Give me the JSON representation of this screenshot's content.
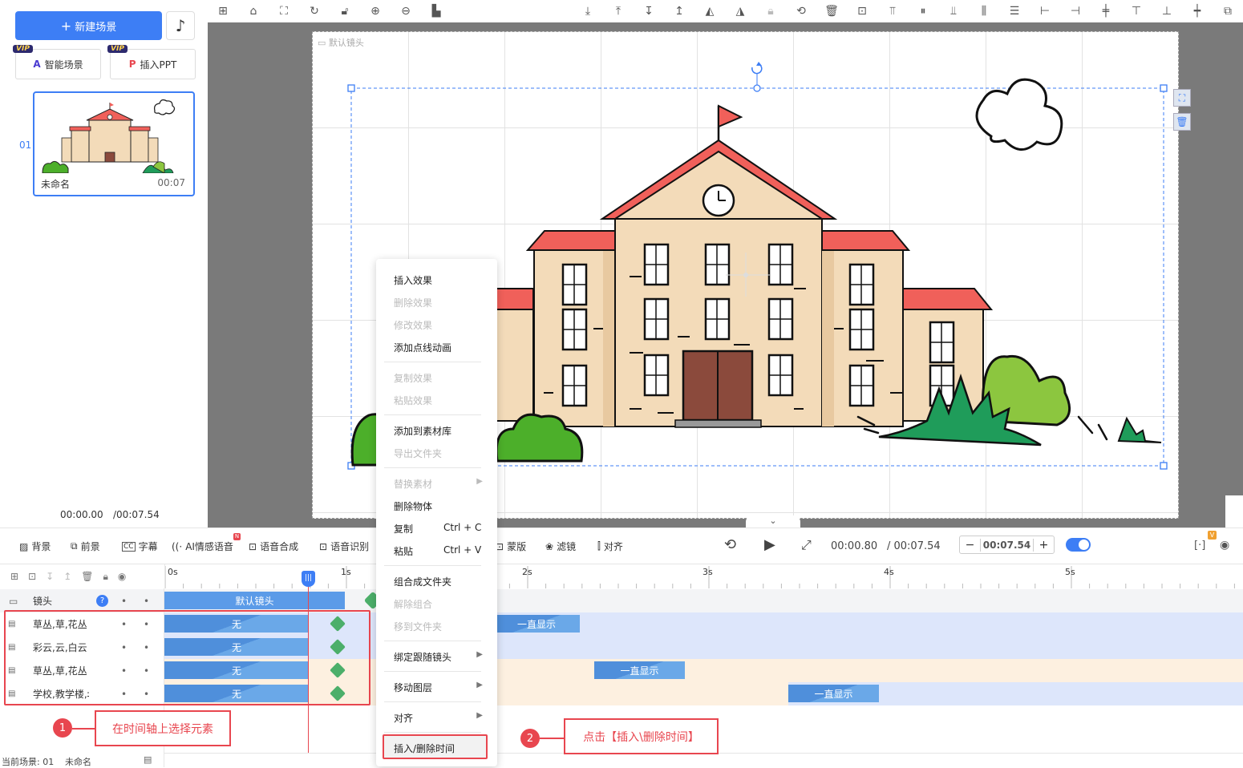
{
  "left_panel": {
    "new_scene": "新建场景",
    "smart_scene": "智能场景",
    "insert_ppt": "插入PPT",
    "vip_badge": "VIP",
    "scene": {
      "index": "01",
      "name": "未命名",
      "duration": "00:07"
    },
    "time_current": "00:00.00",
    "time_total": "/00:07.54"
  },
  "stage": {
    "camera_label": "默认镜头"
  },
  "controls": {
    "background": "背景",
    "foreground": "前景",
    "subtitle": "字幕",
    "ai_voice": "AI情感语音",
    "ai_badge": "N",
    "tts": "语音合成",
    "asr": "语音识别",
    "mask": "蒙版",
    "filter": "滤镜",
    "align": "对齐",
    "time_current": "00:00.80",
    "time_total": "/ 00:07.54",
    "zoom_value": "00:07.54",
    "minus": "−",
    "plus": "+",
    "v_badge": "V"
  },
  "timeline": {
    "ticks": [
      "0s",
      "1s",
      "2s",
      "3s",
      "4s",
      "5s"
    ],
    "camera_track": {
      "label": "镜头",
      "clip": "默认镜头"
    },
    "tracks": [
      {
        "label": "草丛,草,花丛",
        "clip": "无",
        "end_clip": "一直显示"
      },
      {
        "label": "彩云,云,白云",
        "clip": "无",
        "end_clip": ""
      },
      {
        "label": "草丛,草,花丛",
        "clip": "无",
        "end_clip": "一直显示"
      },
      {
        "label": "学校,教学楼,‡",
        "clip": "无",
        "end_clip": "一直显示"
      }
    ],
    "bottom_scene": "当前场景: 01",
    "bottom_name": "未命名"
  },
  "context_menu": {
    "items": [
      {
        "label": "插入效果",
        "disabled": false
      },
      {
        "label": "删除效果",
        "disabled": true
      },
      {
        "label": "修改效果",
        "disabled": true
      },
      {
        "label": "添加点线动画",
        "disabled": false
      },
      {
        "label": "复制效果",
        "disabled": true
      },
      {
        "label": "粘贴效果",
        "disabled": true
      },
      {
        "label": "添加到素材库",
        "disabled": false
      },
      {
        "label": "导出文件夹",
        "disabled": true
      },
      {
        "label": "替换素材",
        "disabled": true
      },
      {
        "label": "删除物体",
        "disabled": false
      },
      {
        "label": "复制",
        "disabled": false,
        "shortcut": "Ctrl + C"
      },
      {
        "label": "粘贴",
        "disabled": false,
        "shortcut": "Ctrl + V"
      },
      {
        "label": "组合成文件夹",
        "disabled": false
      },
      {
        "label": "解除组合",
        "disabled": true
      },
      {
        "label": "移到文件夹",
        "disabled": true
      },
      {
        "label": "绑定跟随镜头",
        "disabled": false
      },
      {
        "label": "移动图层",
        "disabled": false
      },
      {
        "label": "对齐",
        "disabled": false
      },
      {
        "label": "插入/删除时间",
        "disabled": false
      }
    ]
  },
  "annotations": {
    "step1_num": "1",
    "step1_text": "在时间轴上选择元素",
    "step2_num": "2",
    "step2_text": "点击【插入\\删除时间】"
  },
  "colors": {
    "accent": "#3d7ef5",
    "annotation": "#e8464f",
    "roof": "#f0605a",
    "wall": "#f3dbb9",
    "bush_green": "#4caf2a",
    "grass_dark": "#1f9c5a"
  }
}
